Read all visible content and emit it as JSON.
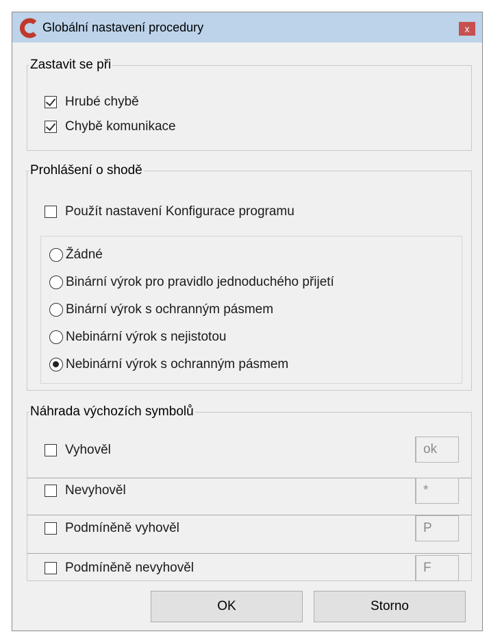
{
  "window": {
    "title": "Globální nastavení procedury",
    "close_glyph": "x",
    "accent_color": "#c0392b",
    "titlebar_color": "#bcd3ea"
  },
  "stop_group": {
    "legend": "Zastavit se při",
    "items": [
      {
        "label": "Hrubé chybě",
        "checked": true
      },
      {
        "label": "Chybě komunikace",
        "checked": true
      }
    ]
  },
  "conformity_group": {
    "legend": "Prohlášení o shodě",
    "use_config_label": "Použít nastavení Konfigurace programu",
    "use_config_checked": false,
    "options": [
      {
        "label": "Žádné",
        "selected": false
      },
      {
        "label": "Binární výrok pro pravidlo jednoduchého přijetí",
        "selected": false
      },
      {
        "label": "Binární výrok s ochranným pásmem",
        "selected": false
      },
      {
        "label": "Nebinární výrok s nejistotou",
        "selected": false
      },
      {
        "label": "Nebinární výrok s ochranným pásmem",
        "selected": true
      }
    ]
  },
  "symbols_group": {
    "legend": "Náhrada výchozích symbolů",
    "rows": [
      {
        "label": "Vyhověl",
        "checked": false,
        "value": "ok"
      },
      {
        "label": "Nevyhověl",
        "checked": false,
        "value": "*"
      },
      {
        "label": "Podmíněně vyhověl",
        "checked": false,
        "value": "P"
      },
      {
        "label": "Podmíněně nevyhověl",
        "checked": false,
        "value": "F"
      }
    ]
  },
  "buttons": {
    "ok": "OK",
    "cancel": "Storno"
  }
}
